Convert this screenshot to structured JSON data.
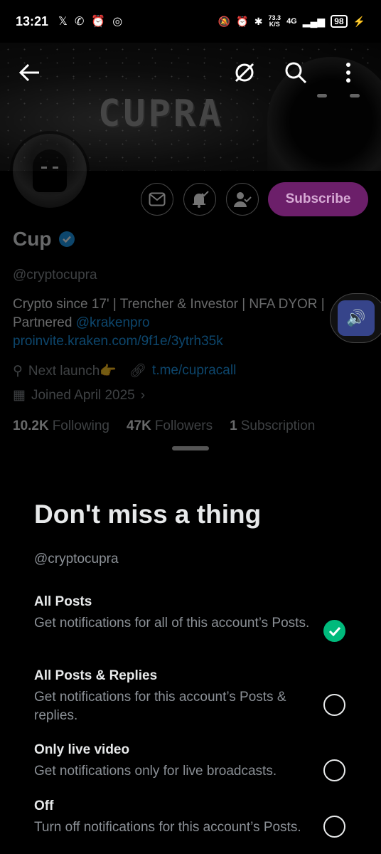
{
  "status_bar": {
    "time": "13:21",
    "speed_value": "73.3",
    "speed_unit": "K/S",
    "network": "4G",
    "battery": "98"
  },
  "banner": {
    "logo_text": "CUPRA"
  },
  "profile": {
    "name": "Cup",
    "handle": "@cryptocupra",
    "bio_text": "Crypto since 17' | Trencher & Investor | NFA DYOR | Partnered ",
    "bio_mention": "@krakenpro",
    "bio_link": " proinvite.kraken.com/9f1e/3ytrh35k",
    "location": "Next launch👉",
    "website": "t.me/cupracall",
    "joined": "Joined April 2025",
    "subscribe_label": "Subscribe",
    "stats": {
      "following_count": "10.2K",
      "following_label": "Following",
      "followers_count": "47K",
      "followers_label": "Followers",
      "subscription_count": "1",
      "subscription_label": "Subscription"
    }
  },
  "sheet": {
    "title": "Don't miss a thing",
    "handle": "@cryptocupra",
    "options": [
      {
        "title": "All Posts",
        "desc": "Get notifications for all of this account’s Posts.",
        "selected": true
      },
      {
        "title": "All Posts & Replies",
        "desc": "Get notifications for this account’s Posts & replies.",
        "selected": false
      },
      {
        "title": "Only live video",
        "desc": "Get notifications only for live broadcasts.",
        "selected": false
      },
      {
        "title": "Off",
        "desc": "Turn off notifications for this account’s Posts.",
        "selected": false
      }
    ]
  },
  "colors": {
    "accent_blue": "#1d9bf0",
    "subscribe_bg": "#6c1f6a",
    "selected_green": "#00ba7c"
  }
}
